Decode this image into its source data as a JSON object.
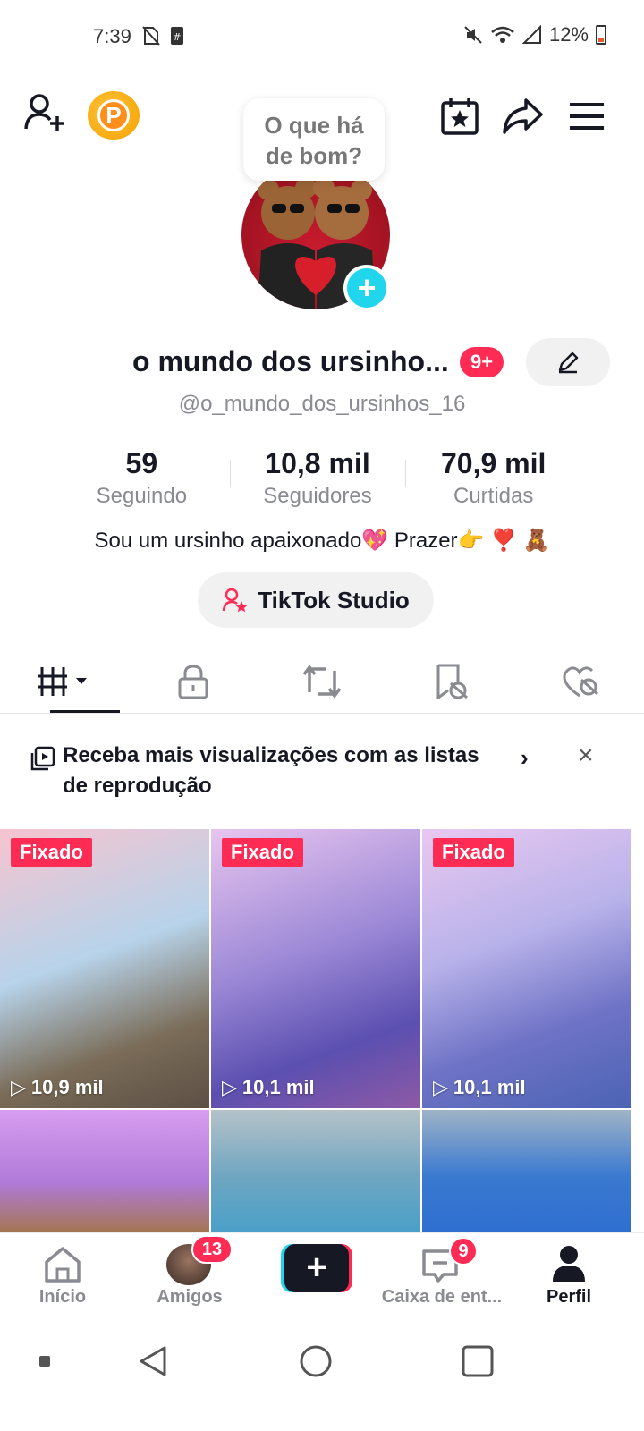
{
  "status_bar": {
    "time": "7:39",
    "battery": "12%"
  },
  "bubble": {
    "line1": "O que há",
    "line2": "de bom?"
  },
  "profile": {
    "display_name": "o mundo dos ursinho...",
    "notif_badge": "9+",
    "username": "@o_mundo_dos_ursinhos_16",
    "bio": "Sou um ursinho apaixonado💖 Prazer👉 ❣️ 🧸"
  },
  "stats": [
    {
      "value": "59",
      "label": "Seguindo"
    },
    {
      "value": "10,8 mil",
      "label": "Seguidores"
    },
    {
      "value": "70,9 mil",
      "label": "Curtidas"
    }
  ],
  "studio_button": "TikTok Studio",
  "playlist_banner": {
    "text": "Receba mais visualizações com as listas de reprodução",
    "close": "×",
    "chevron": "›"
  },
  "videos": [
    {
      "pinned": "Fixado",
      "views": "10,9 mil",
      "bg": "linear-gradient(160deg,#f6c4cf 0%,#b7d3ea 45%,#7a6c58 75%,#5d4f44 100%)"
    },
    {
      "pinned": "Fixado",
      "views": "10,1 mil",
      "bg": "linear-gradient(160deg,#e8c5ef 0%,#9b88d6 45%,#5b4fb0 75%,#8d5aa6 100%)"
    },
    {
      "pinned": "Fixado",
      "views": "10,1 mil",
      "bg": "linear-gradient(160deg,#e9c8f0 0%,#b8b2ea 40%,#6f73c6 70%,#4b63b4 100%)"
    },
    {
      "pinned": "",
      "views": "",
      "bg": "linear-gradient(180deg,#d79df0 0%,#b07ad8 60%,#a57654 100%)"
    },
    {
      "pinned": "",
      "views": "",
      "bg": "linear-gradient(180deg,#b5c2c8 0%,#6fa6c2 55%,#4aa0c8 100%)"
    },
    {
      "pinned": "",
      "views": "",
      "bg": "linear-gradient(180deg,#9fb3c7 0%,#3a79d0 55%,#2f6fd0 100%)"
    }
  ],
  "nav": {
    "home": "Início",
    "friends": "Amigos",
    "friends_badge": "13",
    "inbox": "Caixa de ent...",
    "inbox_badge": "9",
    "profile": "Perfil"
  }
}
